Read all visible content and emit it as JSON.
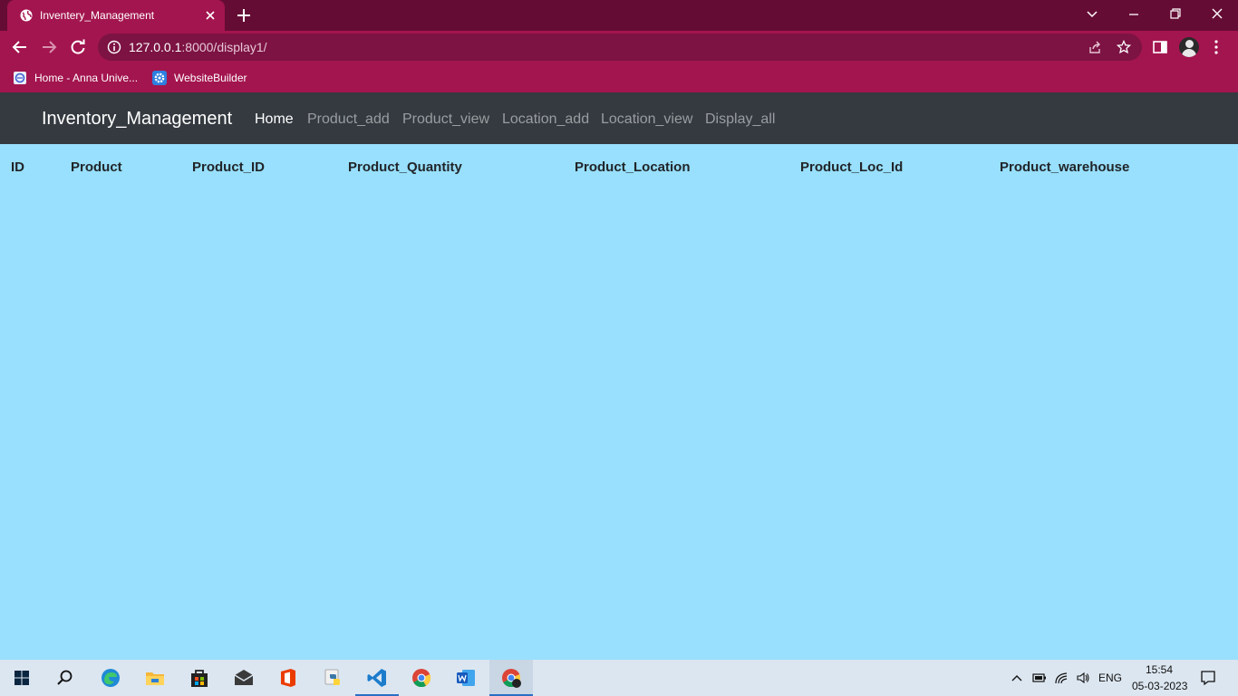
{
  "browser": {
    "tab_title": "Inventery_Management",
    "url_host": "127.0.0.1",
    "url_rest": ":8000/display1/",
    "bookmarks": [
      "Home - Anna Unive...",
      "WebsiteBuilder"
    ]
  },
  "page": {
    "brand": "Inventory_Management",
    "nav": [
      "Home",
      "Product_add",
      "Product_view",
      "Location_add",
      "Location_view",
      "Display_all"
    ],
    "active_nav": "Home",
    "table_headers": [
      "ID",
      "Product",
      "Product_ID",
      "Product_Quantity",
      "Product_Location",
      "Product_Loc_Id",
      "Product_warehouse"
    ]
  },
  "taskbar": {
    "apps": [
      "start-icon",
      "search-icon",
      "edge-icon",
      "file-explorer-icon",
      "store-icon",
      "mail-icon",
      "office-icon",
      "python-icon",
      "vscode-icon",
      "chrome-icon",
      "word-icon",
      "chrome-profile-icon"
    ],
    "language": "ENG",
    "time": "15:54",
    "date": "05-03-2023"
  },
  "colors": {
    "tab_strip": "#650c35",
    "toolbar": "#a3154f",
    "navbar": "#343a40",
    "page_background": "#98e0fd"
  }
}
